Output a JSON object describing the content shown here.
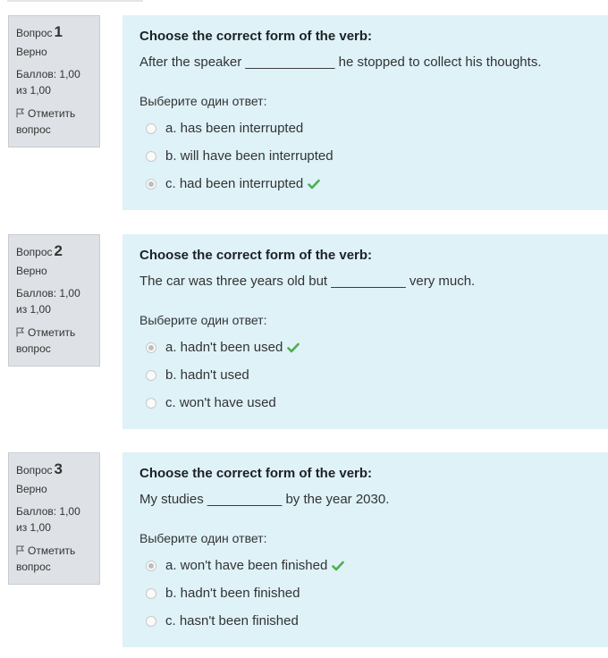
{
  "questions": [
    {
      "label": "Вопрос",
      "number": "1",
      "state": "Верно",
      "grade": "Баллов: 1,00 из 1,00",
      "flag": "Отметить вопрос",
      "title": "Choose the correct form of the verb:",
      "text": "After the speaker ____________ he stopped to collect his thoughts.",
      "select_label": "Выберите один ответ:",
      "answers": [
        {
          "label": "a. has been interrupted",
          "checked": false,
          "correct": false
        },
        {
          "label": "b. will have been interrupted",
          "checked": false,
          "correct": false
        },
        {
          "label": "c. had been interrupted",
          "checked": true,
          "correct": true
        }
      ]
    },
    {
      "label": "Вопрос",
      "number": "2",
      "state": "Верно",
      "grade": "Баллов: 1,00 из 1,00",
      "flag": "Отметить вопрос",
      "title": "Choose the correct form of the verb:",
      "text": "The car was three years old but __________ very much.",
      "select_label": "Выберите один ответ:",
      "answers": [
        {
          "label": "a. hadn't been used",
          "checked": true,
          "correct": true
        },
        {
          "label": "b. hadn't used",
          "checked": false,
          "correct": false
        },
        {
          "label": "c. won't have used",
          "checked": false,
          "correct": false
        }
      ]
    },
    {
      "label": "Вопрос",
      "number": "3",
      "state": "Верно",
      "grade": "Баллов: 1,00 из 1,00",
      "flag": "Отметить вопрос",
      "title": "Choose the correct form of the verb:",
      "text": "My studies __________ by the year 2030.",
      "select_label": "Выберите один ответ:",
      "answers": [
        {
          "label": "a. won't have been finished",
          "checked": true,
          "correct": true
        },
        {
          "label": "b. hadn't been finished",
          "checked": false,
          "correct": false
        },
        {
          "label": "c. hasn't been finished",
          "checked": false,
          "correct": false
        }
      ]
    }
  ],
  "colors": {
    "info_bg": "#dee2e6",
    "content_bg": "#def2f8",
    "correct_check": "#4caf50"
  },
  "icons": {
    "flag": "flag-icon",
    "correct": "check-icon"
  }
}
